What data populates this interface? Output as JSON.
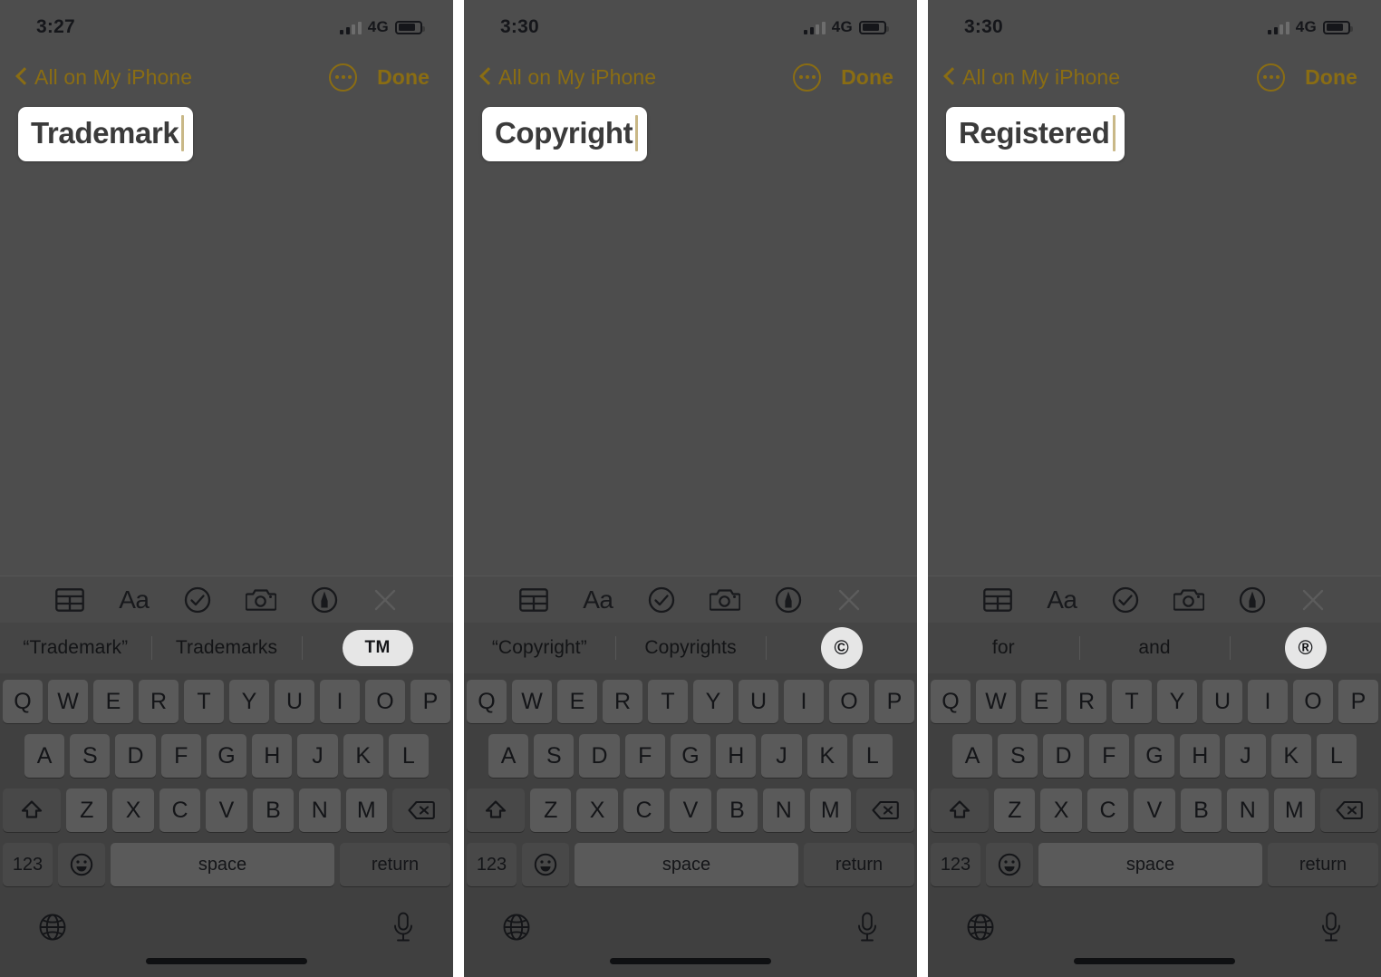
{
  "app": "iOS Notes",
  "colors": {
    "accent": "#8a6d13",
    "overlay_bg": "#4d4d4d",
    "keyboard_bg": "#404040",
    "key_bg": "#5a5a5a",
    "key_dark_bg": "#484848",
    "suggest_bg": "#454545",
    "toolbar_bg": "#4a4a4a",
    "card_bg": "#ffffff",
    "title_text": "#3b3b3b",
    "caret": "#c9b887",
    "pill_bg": "#e6e6e6"
  },
  "toolbar_icons": [
    {
      "name": "table-icon",
      "label": "Table"
    },
    {
      "name": "text-format-icon",
      "label": "Aa"
    },
    {
      "name": "checklist-icon",
      "label": "Checklist"
    },
    {
      "name": "camera-icon",
      "label": "Camera"
    },
    {
      "name": "markup-pen-icon",
      "label": "Markup"
    },
    {
      "name": "close-icon",
      "label": "Close"
    }
  ],
  "keyboard": {
    "row1": [
      "Q",
      "W",
      "E",
      "R",
      "T",
      "Y",
      "U",
      "I",
      "O",
      "P"
    ],
    "row2": [
      "A",
      "S",
      "D",
      "F",
      "G",
      "H",
      "J",
      "K",
      "L"
    ],
    "row3": [
      "Z",
      "X",
      "C",
      "V",
      "B",
      "N",
      "M"
    ],
    "shift_icon": "shift-icon",
    "backspace_icon": "backspace-icon",
    "numeric_label": "123",
    "emoji_icon": "emoji-icon",
    "space_label": "space",
    "return_label": "return",
    "globe_icon": "globe-icon",
    "dictation_icon": "microphone-icon"
  },
  "panels": [
    {
      "id": "trademark",
      "status": {
        "time": "3:27",
        "network": "4G",
        "signal_bars": 2,
        "battery_level": 82
      },
      "nav": {
        "back_label": "All on My iPhone",
        "more_label": "More",
        "done_label": "Done"
      },
      "note": {
        "title": "Trademark"
      },
      "suggestions": [
        {
          "text": "“Trademark”",
          "type": "text",
          "selected": false
        },
        {
          "text": "Trademarks",
          "type": "text",
          "selected": false
        },
        {
          "text": "TM",
          "type": "pill-wide",
          "selected": true
        }
      ]
    },
    {
      "id": "copyright",
      "status": {
        "time": "3:30",
        "network": "4G",
        "signal_bars": 2,
        "battery_level": 82
      },
      "nav": {
        "back_label": "All on My iPhone",
        "more_label": "More",
        "done_label": "Done"
      },
      "note": {
        "title": "Copyright"
      },
      "suggestions": [
        {
          "text": "“Copyright”",
          "type": "text",
          "selected": false
        },
        {
          "text": "Copyrights",
          "type": "text",
          "selected": false
        },
        {
          "text": "©",
          "type": "pill-round",
          "selected": true
        }
      ]
    },
    {
      "id": "registered",
      "status": {
        "time": "3:30",
        "network": "4G",
        "signal_bars": 2,
        "battery_level": 82
      },
      "nav": {
        "back_label": "All on My iPhone",
        "more_label": "More",
        "done_label": "Done"
      },
      "note": {
        "title": "Registered"
      },
      "suggestions": [
        {
          "text": "for",
          "type": "text",
          "selected": false
        },
        {
          "text": "and",
          "type": "text",
          "selected": false
        },
        {
          "text": "®",
          "type": "pill-round",
          "selected": true
        }
      ]
    }
  ]
}
